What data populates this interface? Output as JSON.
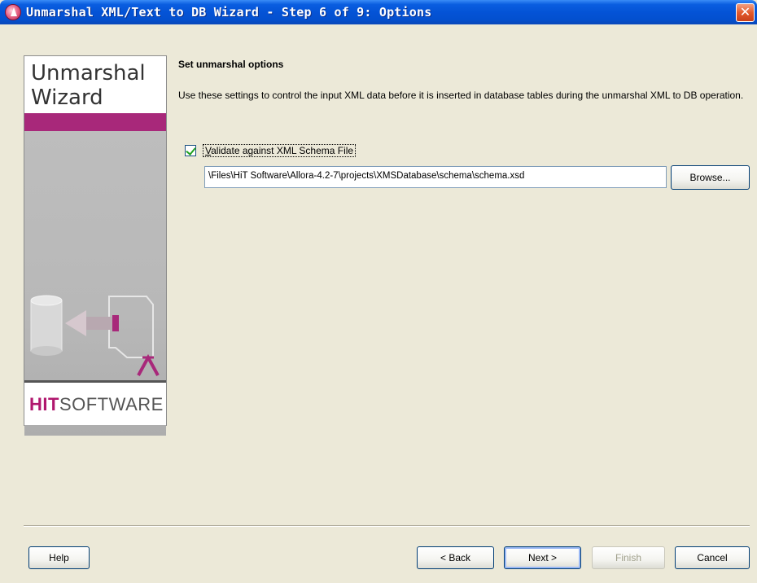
{
  "window": {
    "title": "Unmarshal XML/Text to DB Wizard - Step 6 of 9: Options",
    "close_label": "✕"
  },
  "sidebar": {
    "title": "Unmarshal\nWizard",
    "logo_hit": "HIT",
    "logo_rest": "SOFTWARE",
    "accent_color": "#a8287a"
  },
  "main": {
    "heading": "Set unmarshal options",
    "description": "Use these settings to control the input XML data before it is inserted in database tables during the unmarshal XML to DB operation.",
    "validate_checkbox": {
      "label_underlined": "V",
      "label_rest": "alidate against XML Schema File",
      "checked": true
    },
    "schema_path": "\\Files\\HiT Software\\Allora-4.2-7\\projects\\XMSDatabase\\schema\\schema.xsd",
    "browse_label": "Browse..."
  },
  "footer": {
    "help_label": "Help",
    "back_label": "< Back",
    "next_label": "Next >",
    "finish_label": "Finish",
    "cancel_label": "Cancel"
  }
}
